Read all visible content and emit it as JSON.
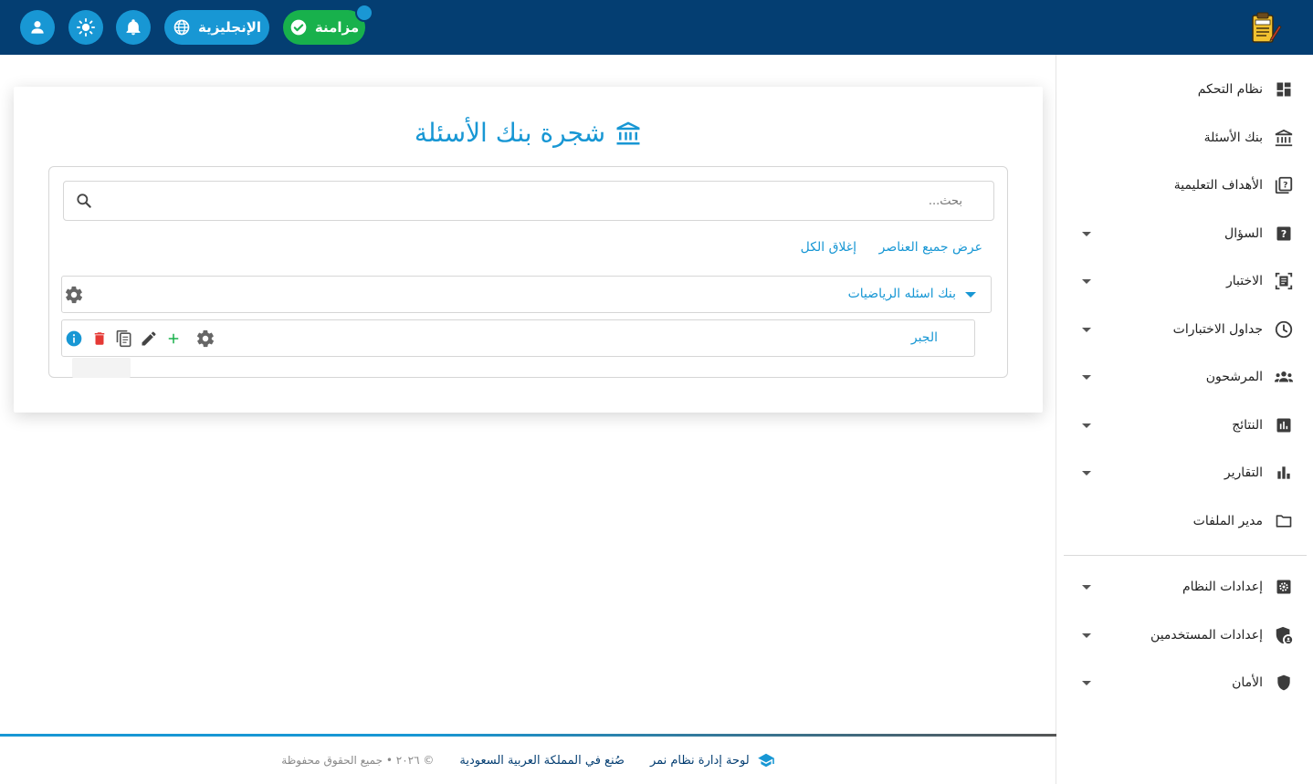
{
  "header": {
    "sync_label": "مزامنة",
    "language_label": "الإنجليزية",
    "colors": {
      "bar": "#043e72",
      "accent": "#1897d4",
      "sync": "#18b14c"
    },
    "icons": [
      "user-icon",
      "brightness-icon",
      "bell-icon",
      "globe-icon",
      "check-circle-icon",
      "exam-logo-icon"
    ]
  },
  "sidebar": {
    "items": [
      {
        "label": "نظام التحكم",
        "icon": "dashboard-icon",
        "has_caret": false
      },
      {
        "label": "بنك الأسئلة",
        "icon": "bank-icon",
        "has_caret": false
      },
      {
        "label": "الأهداف التعليمية",
        "icon": "quiz-icon",
        "has_caret": false
      },
      {
        "label": "السؤال",
        "icon": "help-box-icon",
        "has_caret": true
      },
      {
        "label": "الاختبار",
        "icon": "document-scanner-icon",
        "has_caret": true
      },
      {
        "label": "جداول الاختبارات",
        "icon": "clock-icon",
        "has_caret": true
      },
      {
        "label": "المرشحون",
        "icon": "groups-icon",
        "has_caret": true
      },
      {
        "label": "النتائج",
        "icon": "poll-icon",
        "has_caret": true
      },
      {
        "label": "التقارير",
        "icon": "bar-chart-icon",
        "has_caret": true
      },
      {
        "label": "مدير الملفات",
        "icon": "folder-icon",
        "has_caret": false
      },
      {
        "label": "إعدادات النظام",
        "icon": "settings-box-icon",
        "has_caret": true
      },
      {
        "label": "إعدادات المستخدمين",
        "icon": "admin-shield-icon",
        "has_caret": true
      },
      {
        "label": "الأمان",
        "icon": "shield-icon",
        "has_caret": true
      }
    ]
  },
  "main": {
    "title": "شجرة بنك الأسئلة",
    "search_placeholder": "بحث...",
    "expand_all_label": "عرض جميع العناصر",
    "collapse_all_label": "إغلاق الكل",
    "tree": {
      "root": {
        "label": "بنك اسئله الرياضيات",
        "expanded": true
      },
      "child": {
        "label": "الجبر"
      }
    },
    "node_action_icons": [
      "settings-icon",
      "add-icon",
      "edit-icon",
      "copy-icon",
      "delete-icon",
      "info-icon"
    ]
  },
  "footer": {
    "brand": "لوحة إدارة نظام نمر",
    "made_in": "صُنع في المملكة العربية السعودية",
    "rights": "© ٢٠٢٦ • جميع الحقوق محفوظة"
  }
}
